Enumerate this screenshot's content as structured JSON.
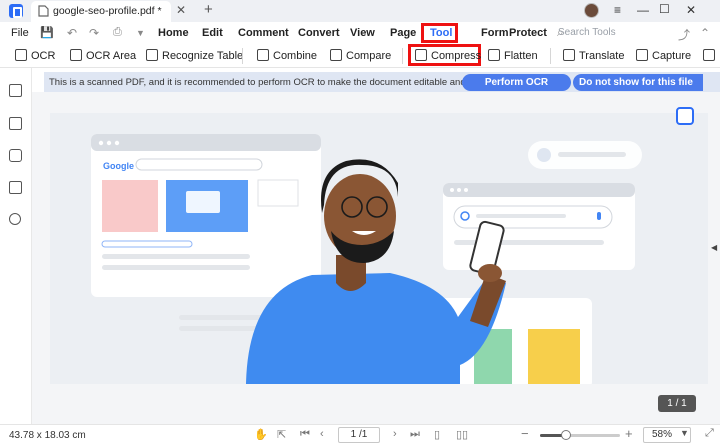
{
  "tab": {
    "title": "google-seo-profile.pdf *"
  },
  "menu": [
    "File",
    "Home",
    "Edit",
    "Comment",
    "Convert",
    "View",
    "Page",
    "Tool",
    "Form",
    "Protect"
  ],
  "search": {
    "placeholder": "Search Tools"
  },
  "toolbar": [
    "OCR",
    "OCR Area",
    "Recognize Table",
    "Combine",
    "Compare",
    "Compress",
    "Flatten",
    "Translate",
    "Capture"
  ],
  "notice": {
    "text": "This is a scanned PDF, and it is recommended to perform OCR to make the document editable and searchable.",
    "perform_ocr": "Perform OCR",
    "dont_show": "Do not show for this file"
  },
  "page_counter": "1 / 1",
  "status": {
    "dimensions": "43.78 x 18.03 cm",
    "page_input": "1 /1",
    "zoom": "58%",
    "zoom_level": 0.33
  },
  "colors": {
    "accent": "#2d6df6",
    "highlight": "#ee1111",
    "shirt": "#3f8bf0"
  },
  "illustration": {
    "brand": "Google"
  }
}
